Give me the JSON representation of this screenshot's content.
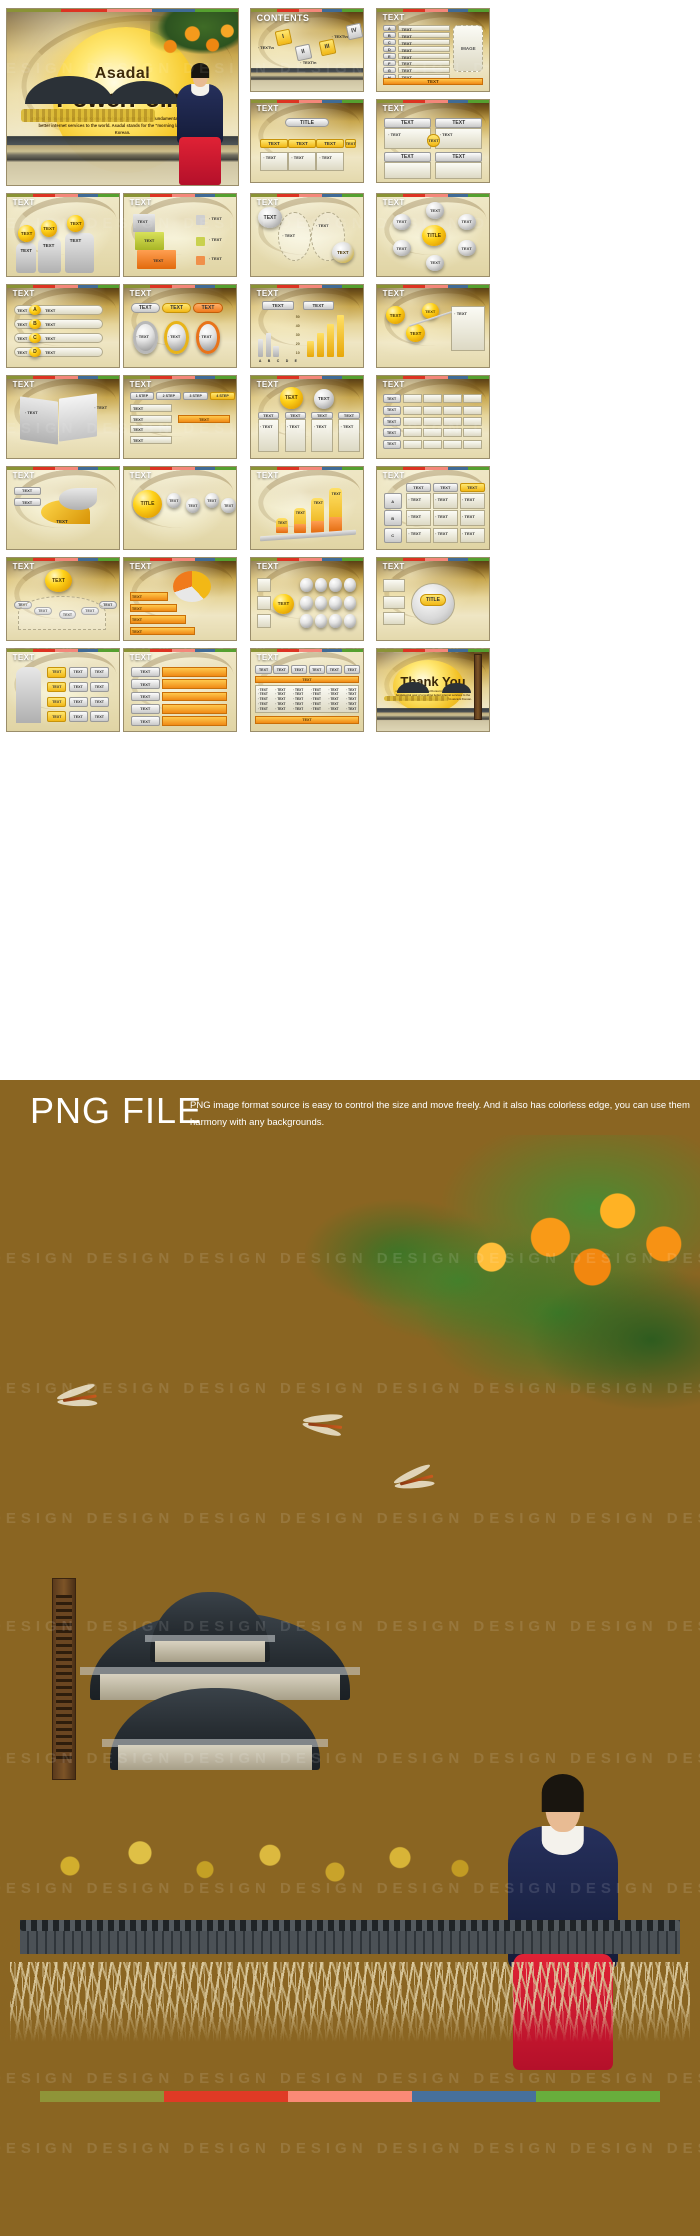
{
  "hero": {
    "brand": "Asadal",
    "product": "PowerPoint",
    "paragraph": "started its business in Seoul Korea in February 1998 with the fundamental goal of providing better internet services to the world. Asadal stands for the \"morning land\" in ancient Korean."
  },
  "labels": {
    "text": "TEXT",
    "title": "TITLE",
    "contents": "CONTENTS",
    "image": "IMAGE",
    "thankyou": "Thank You",
    "step1": "1 STEP",
    "step2": "2 STEP",
    "step3": "3 STEP",
    "step4": "4 STEP",
    "bullet": "· TEXT"
  },
  "letters": [
    "A",
    "B",
    "C",
    "D",
    "E",
    "F",
    "G",
    "H"
  ],
  "romans": [
    "I",
    "II",
    "III",
    "IV"
  ],
  "chart_axis": [
    "50",
    "40",
    "30",
    "20",
    "10"
  ],
  "chart_cats": [
    "A",
    "B",
    "C",
    "D",
    "E"
  ],
  "png_section": {
    "title": "PNG FILE",
    "description": "PNG image format source is easy to control the size and move freely. And it also has colorless edge, you can use them harmony with any backgrounds."
  },
  "watermark": "DESIGN DESIGN DESIGN DESIGN DESIGN DESIGN DESIGN DESIGN DESIGN DESIGN DESIGN DESIGN DESIGN DESIGN",
  "palette": [
    {
      "name": "olive",
      "hex": "#8f9438"
    },
    {
      "name": "red",
      "hex": "#e03a25"
    },
    {
      "name": "salmon",
      "hex": "#fa8a76"
    },
    {
      "name": "blue",
      "hex": "#47709b"
    },
    {
      "name": "green",
      "hex": "#68ad3c"
    }
  ],
  "theme": {
    "page_bg": "#8a6522",
    "panel_bg": "#ffffff",
    "accent_yellow": "#f2b816",
    "accent_orange": "#f07a1c",
    "slide_border": "#9a8d6a"
  },
  "slides": [
    {
      "n": 1,
      "title": "CONTENTS",
      "kind": "contents"
    },
    {
      "n": 2,
      "title": "TEXT",
      "kind": "list-image"
    },
    {
      "n": 3,
      "title": "TEXT",
      "kind": "title-chips"
    },
    {
      "n": 4,
      "title": "TEXT",
      "kind": "two-cards"
    },
    {
      "n": 5,
      "title": "TEXT",
      "kind": "cylinders"
    },
    {
      "n": 6,
      "title": "TEXT",
      "kind": "cubes"
    },
    {
      "n": 7,
      "title": "TEXT",
      "kind": "ovals"
    },
    {
      "n": 8,
      "title": "TEXT",
      "kind": "orbit"
    },
    {
      "n": 9,
      "title": "TEXT",
      "kind": "abc-rows"
    },
    {
      "n": 10,
      "title": "TEXT",
      "kind": "three-rings"
    },
    {
      "n": 11,
      "title": "TEXT",
      "kind": "bar-chart"
    },
    {
      "n": 12,
      "title": "TEXT",
      "kind": "swoosh"
    },
    {
      "n": 13,
      "title": "TEXT",
      "kind": "book"
    },
    {
      "n": 14,
      "title": "TEXT",
      "kind": "steps"
    },
    {
      "n": 15,
      "title": "TEXT",
      "kind": "four-cols"
    },
    {
      "n": 16,
      "title": "TEXT",
      "kind": "grid-rows"
    },
    {
      "n": 17,
      "title": "TEXT",
      "kind": "cycle-arrow"
    },
    {
      "n": 18,
      "title": "TEXT",
      "kind": "title-fan"
    },
    {
      "n": 19,
      "title": "TEXT",
      "kind": "bar-steps"
    },
    {
      "n": 20,
      "title": "TEXT",
      "kind": "matrix"
    },
    {
      "n": 21,
      "title": "TEXT",
      "kind": "fan-text"
    },
    {
      "n": 22,
      "title": "TEXT",
      "kind": "pie-bars"
    },
    {
      "n": 23,
      "title": "TEXT",
      "kind": "pearl-grid"
    },
    {
      "n": 24,
      "title": "TEXT",
      "kind": "ring-title"
    },
    {
      "n": 25,
      "title": "TEXT",
      "kind": "house-grid"
    },
    {
      "n": 26,
      "title": "TEXT",
      "kind": "stack-rows"
    },
    {
      "n": 27,
      "title": "TEXT",
      "kind": "wide-table"
    },
    {
      "n": 28,
      "title": "Thank You",
      "kind": "thankyou"
    }
  ]
}
